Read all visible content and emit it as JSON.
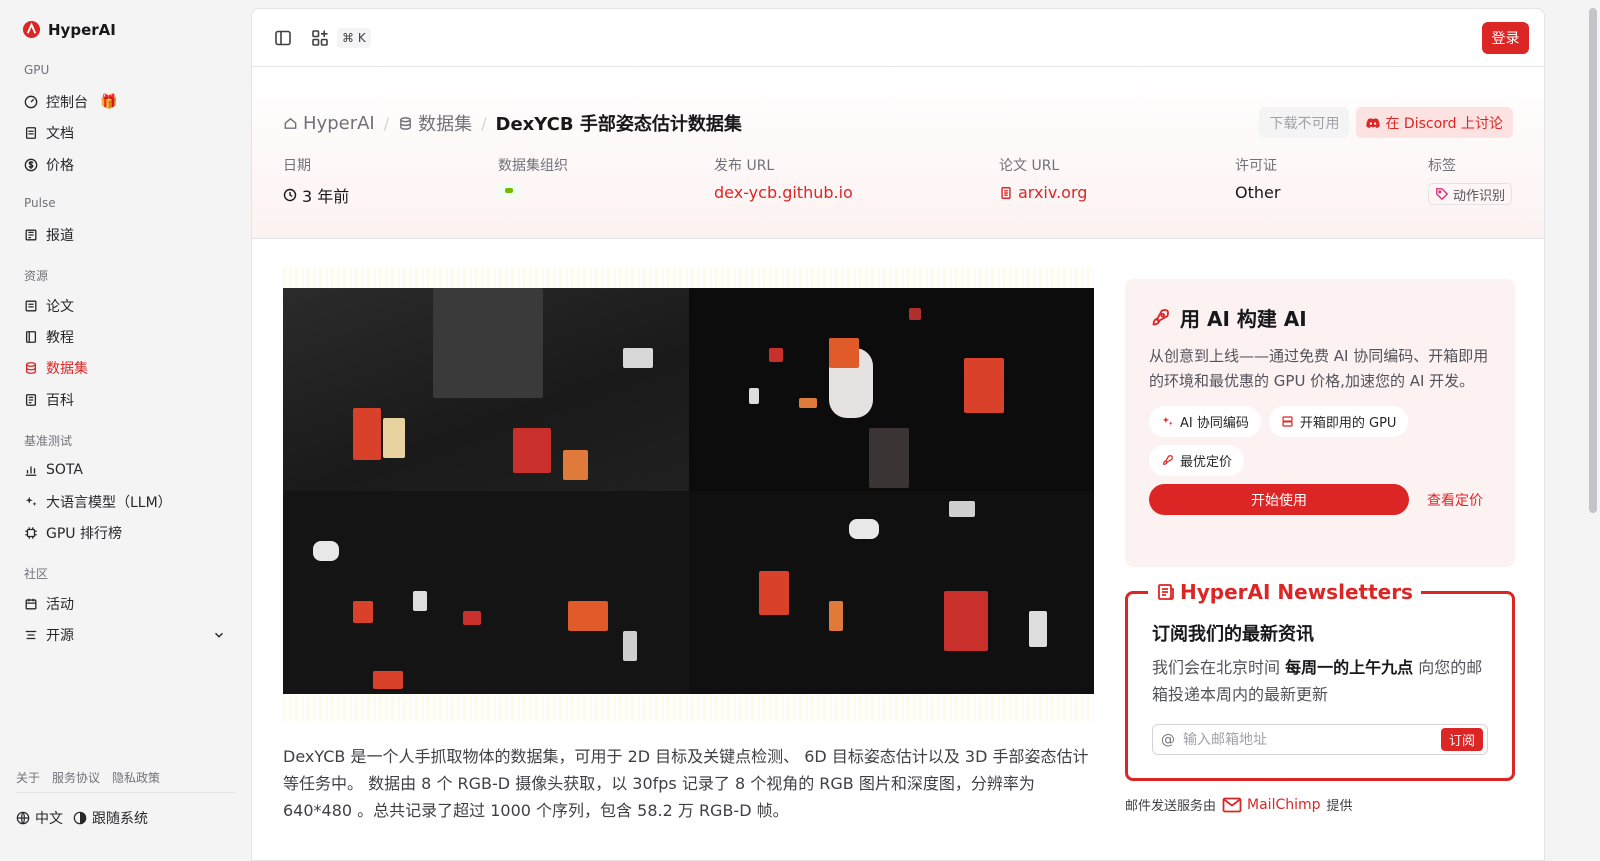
{
  "brand": {
    "name": "HyperAI"
  },
  "sidebar": {
    "sections": [
      {
        "label": "GPU",
        "items": [
          {
            "label": "控制台",
            "icon": "gauge-icon"
          },
          {
            "label": "文档",
            "icon": "doc-icon"
          },
          {
            "label": "价格",
            "icon": "dollar-icon"
          }
        ]
      },
      {
        "label": "Pulse",
        "items": [
          {
            "label": "报道",
            "icon": "news-icon"
          }
        ]
      },
      {
        "label": "资源",
        "items": [
          {
            "label": "论文",
            "icon": "paper-icon"
          },
          {
            "label": "教程",
            "icon": "book-icon"
          },
          {
            "label": "数据集",
            "icon": "database-icon"
          },
          {
            "label": "百科",
            "icon": "encyclopedia-icon"
          }
        ]
      },
      {
        "label": "基准测试",
        "items": [
          {
            "label": "SOTA",
            "icon": "chart-icon"
          },
          {
            "label": "大语言模型（LLM）",
            "icon": "sparkle-icon"
          },
          {
            "label": "GPU 排行榜",
            "icon": "cpu-icon"
          }
        ]
      },
      {
        "label": "社区",
        "items": [
          {
            "label": "活动",
            "icon": "calendar-icon"
          },
          {
            "label": "开源",
            "icon": "list-icon"
          }
        ]
      }
    ],
    "active_item": "数据集",
    "footer_links": [
      "关于",
      "服务协议",
      "隐私政策"
    ],
    "language": "中文",
    "system_status": "跟随系统"
  },
  "topbar": {
    "shortcut": "⌘ K",
    "login_label": "登录"
  },
  "hero": {
    "breadcrumb": [
      "HyperAI",
      "数据集",
      "DexYCB 手部姿态估计数据集"
    ],
    "download_label": "下载不可用",
    "discord_label": "在 Discord 上讨论",
    "meta": {
      "date_label": "日期",
      "date_value": "3 年前",
      "org_label": "数据集组织",
      "release_label": "发布 URL",
      "release_value": "dex-ycb.github.io",
      "paper_label": "论文 URL",
      "paper_value": "arxiv.org",
      "license_label": "许可证",
      "license_value": "Other",
      "tags_label": "标签",
      "tag_value": "动作识别"
    }
  },
  "description": "DexYCB 是一个人手抓取物体的数据集，可用于 2D 目标及关键点检测、 6D 目标姿态估计以及 3D 手部姿态估计等任务中。 数据由 8 个 RGB-D 摄像头获取，以 30fps 记录了 8 个视角的 RGB 图片和深度图，分辨率为 640*480 。总共记录了超过 1000 个序列，包含 58.2 万 RGB-D 帧。",
  "ai_card": {
    "title": "用 AI 构建 AI",
    "text": "从创意到上线——通过免费 AI 协同编码、开箱即用的环境和最优惠的 GPU 价格,加速您的 AI 开发。",
    "chips": [
      "AI 协同编码",
      "开箱即用的 GPU",
      "最优定价"
    ],
    "start_label": "开始使用",
    "pricing_label": "查看定价"
  },
  "newsletter": {
    "legend": "HyperAI Newsletters",
    "heading": "订阅我们的最新资讯",
    "text_before": "我们会在北京时间 ",
    "text_bold": "每周一的上午九点",
    "text_after": " 向您的邮箱投递本周内的最新更新",
    "placeholder": "输入邮箱地址",
    "subscribe_label": "订阅",
    "credit_before": "邮件发送服务由",
    "credit_brand": "MailChimp",
    "credit_after": "提供"
  },
  "colors": {
    "accent": "#dc2626",
    "accent_soft": "#fdf2f2"
  }
}
